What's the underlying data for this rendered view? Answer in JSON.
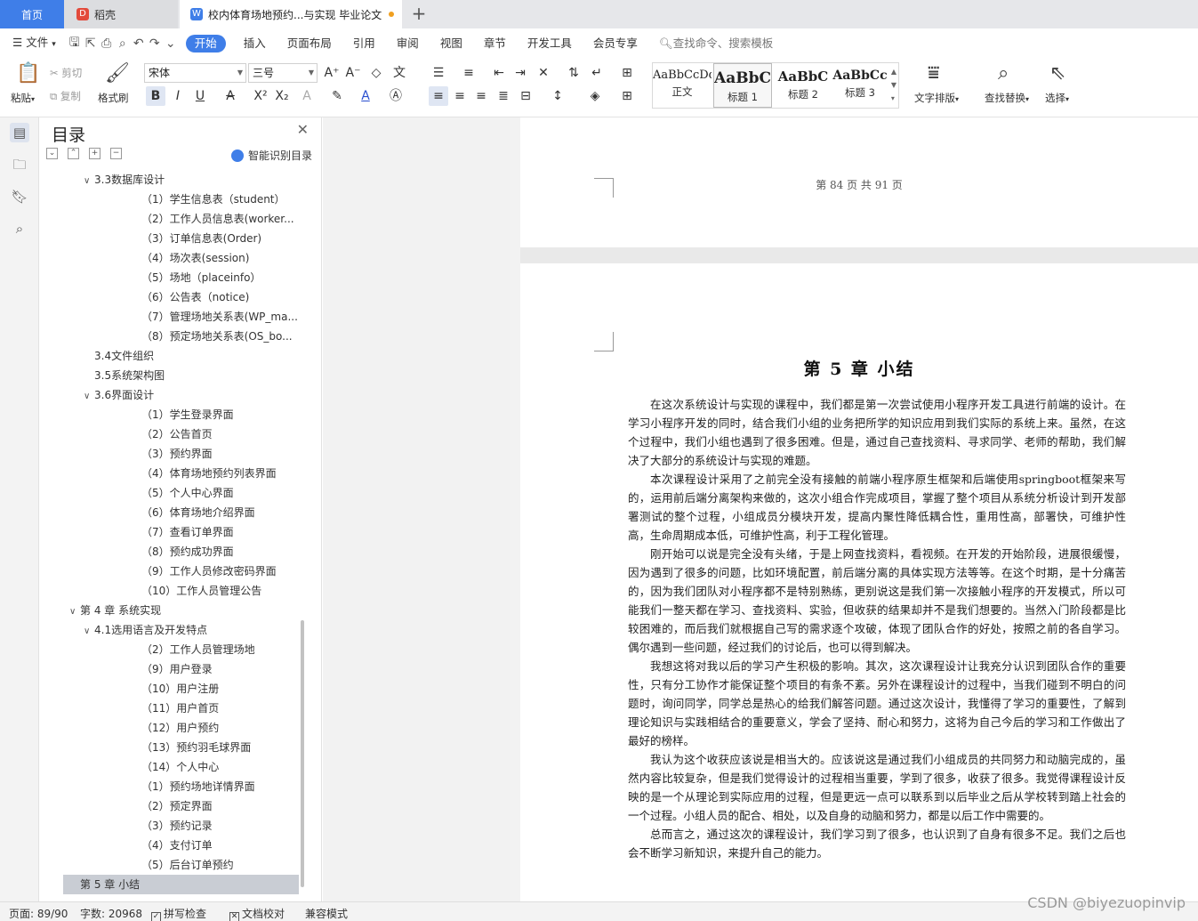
{
  "tabs": {
    "home": "首页",
    "daoke": "稻壳",
    "doc": "校内体育场地预约...与实现 毕业论文",
    "new_tab": "+"
  },
  "menu": {
    "file": "文件",
    "items": [
      "开始",
      "插入",
      "页面布局",
      "引用",
      "审阅",
      "视图",
      "章节",
      "开发工具",
      "会员专享"
    ],
    "search": "查找命令、搜索模板"
  },
  "ribbon": {
    "paste": "粘贴",
    "cut": "剪切",
    "copy": "复制",
    "format_painter": "格式刷",
    "font_name": "宋体",
    "font_size": "三号",
    "styles": [
      {
        "sample": "AaBbCcDd",
        "name": "正文"
      },
      {
        "sample": "AaBbC",
        "name": "标题 1"
      },
      {
        "sample": "AaBbC",
        "name": "标题 2"
      },
      {
        "sample": "AaBbCc",
        "name": "标题 3"
      }
    ],
    "text_layout": "文字排版",
    "find_replace": "查找替换",
    "select": "选择"
  },
  "nav": {
    "title": "目录",
    "smart": "智能识别目录",
    "items": [
      {
        "level": 2,
        "text": "3.3数据库设计",
        "expanded": true
      },
      {
        "level": 3,
        "text": "（1）学生信息表（student）"
      },
      {
        "level": 3,
        "text": "（2）工作人员信息表(worker..."
      },
      {
        "level": 3,
        "text": "（3）订单信息表(Order)"
      },
      {
        "level": 3,
        "text": "（4）场次表(session)"
      },
      {
        "level": 3,
        "text": "（5）场地（placeinfo）"
      },
      {
        "level": 3,
        "text": "（6）公告表（notice)"
      },
      {
        "level": 3,
        "text": "（7）管理场地关系表(WP_ma..."
      },
      {
        "level": 3,
        "text": "（8）预定场地关系表(OS_bo..."
      },
      {
        "level": 2,
        "text": "3.4文件组织"
      },
      {
        "level": 2,
        "text": "3.5系统架构图"
      },
      {
        "level": 2,
        "text": "3.6界面设计",
        "expanded": true
      },
      {
        "level": 3,
        "text": "（1）学生登录界面"
      },
      {
        "level": 3,
        "text": "（2）公告首页"
      },
      {
        "level": 3,
        "text": "（3）预约界面"
      },
      {
        "level": 3,
        "text": "（4）体育场地预约列表界面"
      },
      {
        "level": 3,
        "text": "（5）个人中心界面"
      },
      {
        "level": 3,
        "text": "（6）体育场地介绍界面"
      },
      {
        "level": 3,
        "text": "（7）查看订单界面"
      },
      {
        "level": 3,
        "text": "（8）预约成功界面"
      },
      {
        "level": 3,
        "text": "（9）工作人员修改密码界面"
      },
      {
        "level": 3,
        "text": "（10）工作人员管理公告"
      },
      {
        "level": 1,
        "text": "第 4 章 系统实现",
        "expanded": true
      },
      {
        "level": 2,
        "text": "4.1选用语言及开发特点",
        "expanded": true
      },
      {
        "level": 3,
        "text": "（2）工作人员管理场地"
      },
      {
        "level": 3,
        "text": "（9）用户登录"
      },
      {
        "level": 3,
        "text": "（10）用户注册"
      },
      {
        "level": 3,
        "text": "（11）用户首页"
      },
      {
        "level": 3,
        "text": "（12）用户预约"
      },
      {
        "level": 3,
        "text": "（13）预约羽毛球界面"
      },
      {
        "level": 3,
        "text": "（14）个人中心"
      },
      {
        "level": 3,
        "text": "（1）预约场地详情界面"
      },
      {
        "level": 3,
        "text": "（2）预定界面"
      },
      {
        "level": 3,
        "text": "（3）预约记录"
      },
      {
        "level": 3,
        "text": "（4）支付订单"
      },
      {
        "level": 3,
        "text": "（5）后台订单预约"
      },
      {
        "level": 1,
        "text": "第 5 章 小结",
        "selected": true
      }
    ]
  },
  "document": {
    "page_number": "第 84 页 共 91 页",
    "chapter_title": "第 5 章 小结",
    "paragraphs": [
      "在这次系统设计与实现的课程中，我们都是第一次尝试使用小程序开发工具进行前端的设计。在学习小程序开发的同时，结合我们小组的业务把所学的知识应用到我们实际的系统上来。虽然，在这个过程中，我们小组也遇到了很多困难。但是，通过自己查找资料、寻求同学、老师的帮助，我们解决了大部分的系统设计与实现的难题。",
      "本次课程设计采用了之前完全没有接触的前端小程序原生框架和后端使用springboot框架来写的，运用前后端分离架构来做的，这次小组合作完成项目，掌握了整个项目从系统分析设计到开发部署测试的整个过程，小组成员分模块开发，提高内聚性降低耦合性，重用性高，部署快，可维护性高，生命周期成本低，可维护性高，利于工程化管理。",
      "刚开始可以说是完全没有头绪，于是上网查找资料，看视频。在开发的开始阶段，进展很缓慢，因为遇到了很多的问题，比如环境配置，前后端分离的具体实现方法等等。在这个时期，是十分痛苦的，因为我们团队对小程序都不是特别熟练，更别说这是我们第一次接触小程序的开发模式，所以可能我们一整天都在学习、查找资料、实验，但收获的结果却并不是我们想要的。当然入门阶段都是比较困难的，而后我们就根据自己写的需求逐个攻破，体现了团队合作的好处，按照之前的各自学习。偶尔遇到一些问题，经过我们的讨论后，也可以得到解决。",
      "我想这将对我以后的学习产生积极的影响。其次，这次课程设计让我充分认识到团队合作的重要性，只有分工协作才能保证整个项目的有条不紊。另外在课程设计的过程中，当我们碰到不明白的问题时，询问同学，同学总是热心的给我们解答问题。通过这次设计，我懂得了学习的重要性，了解到理论知识与实践相结合的重要意义，学会了坚持、耐心和努力，这将为自己今后的学习和工作做出了最好的榜样。",
      "我认为这个收获应该说是相当大的。应该说这是通过我们小组成员的共同努力和动脑完成的，虽然内容比较复杂，但是我们觉得设计的过程相当重要，学到了很多，收获了很多。我觉得课程设计反映的是一个从理论到实际应用的过程，但是更远一点可以联系到以后毕业之后从学校转到踏上社会的一个过程。小组人员的配合、相处，以及自身的动脑和努力，都是以后工作中需要的。",
      "总而言之，通过这次的课程设计，我们学习到了很多，也认识到了自身有很多不足。我们之后也会不断学习新知识，来提升自己的能力。"
    ]
  },
  "status": {
    "page": "页面: 89/90",
    "words": "字数: 20968",
    "spell": "拼写检查",
    "proof": "文档校对",
    "compat": "兼容模式"
  },
  "watermark": "CSDN @biyezuopinvip"
}
